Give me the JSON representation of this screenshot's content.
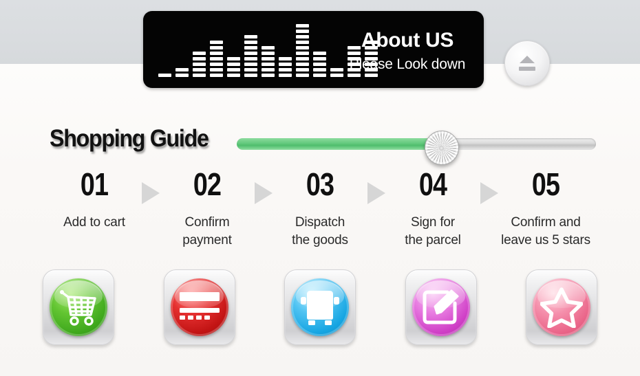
{
  "banner": {
    "title": "About US",
    "subtitle": "Please Look down",
    "equalizer_icon": "equalizer-bars-icon",
    "equalizer_levels": [
      1,
      2,
      5,
      7,
      4,
      8,
      6,
      4,
      10,
      5,
      2,
      6,
      7
    ],
    "background_color": "#040404",
    "text_color": "#ffffff"
  },
  "eject_button": {
    "icon": "eject-icon",
    "label": ""
  },
  "guide": {
    "title": "Shopping Guide"
  },
  "slider": {
    "value_percent": 57,
    "fill_color": "#4fbd6c",
    "track_color": "#d9d9d9",
    "knob_icon": "metal-knob-icon"
  },
  "steps": [
    {
      "number": "01",
      "label": "Add to cart",
      "icon": "shopping-cart-icon",
      "color": "#4fbd2e"
    },
    {
      "number": "02",
      "label": "Confirm\npayment",
      "icon": "credit-card-icon",
      "color": "#d92626"
    },
    {
      "number": "03",
      "label": "Dispatch\nthe goods",
      "icon": "delivery-truck-icon",
      "color": "#2aaee6"
    },
    {
      "number": "04",
      "label": "Sign for\nthe parcel",
      "icon": "pencil-edit-icon",
      "color": "#d44ccb"
    },
    {
      "number": "05",
      "label": "Confirm and\nleave us 5 stars",
      "icon": "star-icon",
      "color": "#ec6d8f"
    }
  ],
  "arrow_icon": "chevron-right-triangle-icon",
  "background": {
    "top_color": "#dadde0",
    "bottom_color": "#faf8f7"
  }
}
